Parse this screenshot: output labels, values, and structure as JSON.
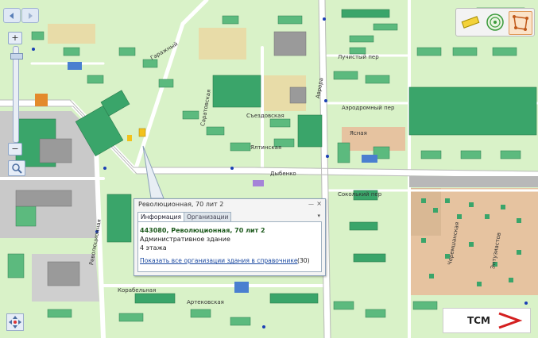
{
  "popup": {
    "title": "Революционная, 70 лит 2",
    "minimize": "—",
    "close": "×",
    "tabs": [
      {
        "label": "Информация",
        "active": true
      },
      {
        "label": "Организации",
        "active": false
      }
    ],
    "address": "443080, Революционная, 70 лит 2",
    "building_type": "Административное здание",
    "floors": "4 этажа",
    "org_link": "Показать все организации здания в справочнике",
    "org_count": "(30)"
  },
  "streets": [
    {
      "label": "Гаражный",
      "angle": -30
    },
    {
      "label": "Саратовская",
      "angle": -80
    },
    {
      "label": "Аврора",
      "angle": -80
    },
    {
      "label": "Лучистый пер",
      "angle": 0
    },
    {
      "label": "Аэродромный пер",
      "angle": 0
    },
    {
      "label": "Ясная",
      "angle": 0
    },
    {
      "label": "Съездовская",
      "angle": 0
    },
    {
      "label": "Ялтинская",
      "angle": 0
    },
    {
      "label": "Дыбенко",
      "angle": 0
    },
    {
      "label": "Соколький пер",
      "angle": 0
    },
    {
      "label": "Революционная",
      "angle": -80
    },
    {
      "label": "Корабельная",
      "angle": 0
    },
    {
      "label": "Артековская",
      "angle": 0
    },
    {
      "label": "Черемшанская",
      "angle": -80
    },
    {
      "label": "Энтузиастов",
      "angle": -80
    }
  ],
  "controls": {
    "zoom_in": "+",
    "zoom_out": "−"
  },
  "logo": {
    "text": "ТСМ"
  },
  "colors": {
    "land": "#d9f2c8",
    "block": "#b9e6a4",
    "building": "#3aa56a",
    "road": "#ffffff",
    "industrial": "#c9c9c9",
    "private": "#e6c3a0",
    "accent": "#1b3fb5"
  }
}
